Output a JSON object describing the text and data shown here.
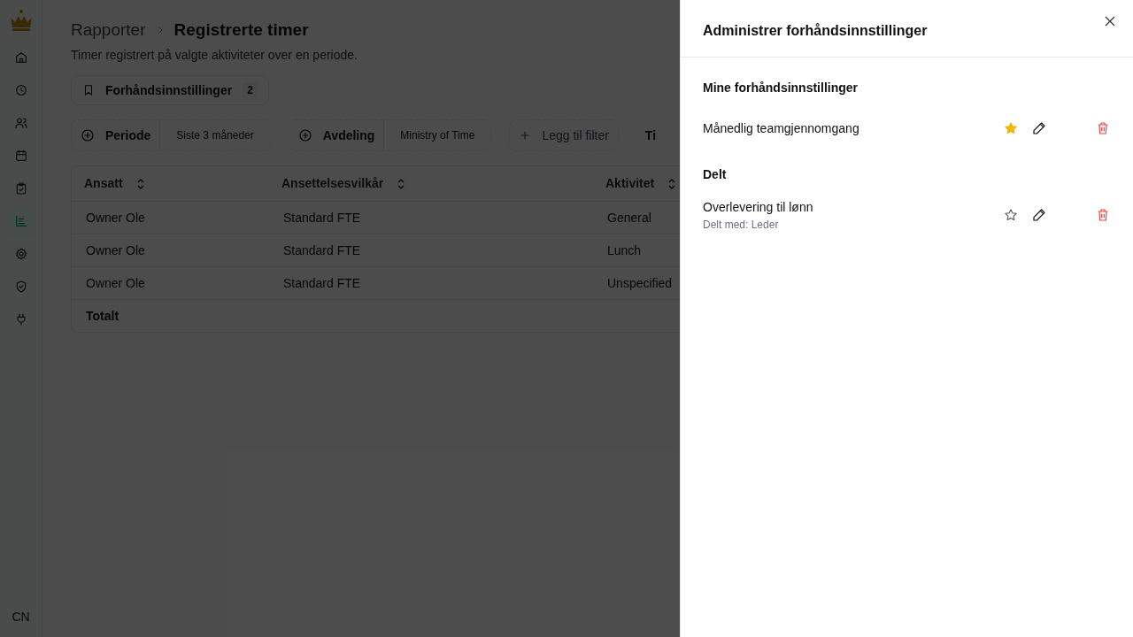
{
  "sidebar": {
    "items": [
      {
        "selected": false
      },
      {
        "selected": false
      },
      {
        "selected": false
      },
      {
        "selected": false
      },
      {
        "selected": false
      },
      {
        "selected": true
      },
      {
        "selected": false
      },
      {
        "selected": false
      },
      {
        "selected": false
      }
    ],
    "avatar": "CN"
  },
  "breadcrumb": [
    "Rapporter",
    "Registrerte timer"
  ],
  "subtitle": "Timer registrert på valgte aktiviteter over en periode.",
  "presets_button": {
    "label": "Forhåndsinnstillinger",
    "count": "2"
  },
  "filters": [
    {
      "kind": "set",
      "label": "Periode",
      "value": "Siste 3 måneder"
    },
    {
      "kind": "set",
      "label": "Avdeling",
      "value": "Ministry of Time"
    },
    {
      "kind": "add",
      "label": "Legg til filter"
    },
    {
      "kind": "plain",
      "label": "Ti"
    }
  ],
  "table": {
    "columns": [
      "Ansatt",
      "Ansettelsesvilkår",
      "Aktivitet"
    ],
    "rows": [
      [
        "Owner Ole",
        "Standard FTE",
        "General"
      ],
      [
        "Owner Ole",
        "Standard FTE",
        "Lunch"
      ],
      [
        "Owner Ole",
        "Standard FTE",
        "Unspecified"
      ]
    ],
    "total": "Totalt"
  },
  "dialog": {
    "title": "Administrer forhåndsinnstillinger",
    "sections": [
      {
        "title": "Mine forhåndsinnstillinger",
        "items": [
          {
            "name": "Månedlig teamgjennomgang",
            "favorite": true
          }
        ]
      },
      {
        "title": "Delt",
        "items": [
          {
            "name": "Overlevering til lønn",
            "subtitle": "Delt med: Leder",
            "favorite": false
          }
        ]
      }
    ]
  }
}
